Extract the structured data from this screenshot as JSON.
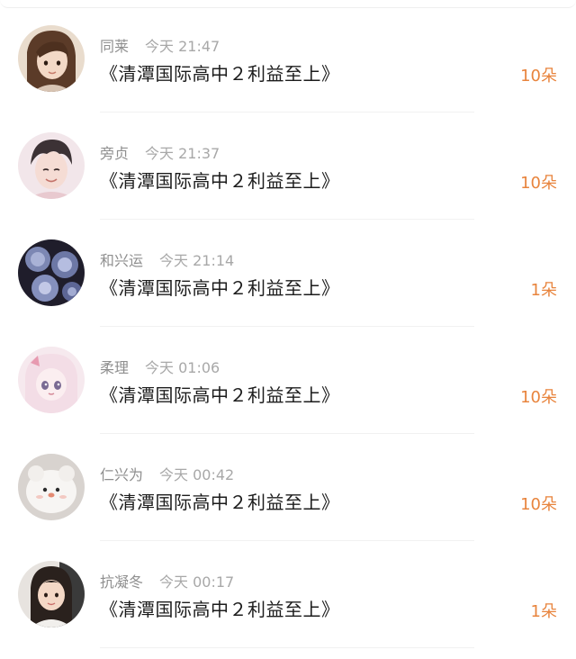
{
  "gifts": [
    {
      "user": "同莱",
      "time": "今天 21:47",
      "book": "《清潭国际高中２利益至上》",
      "count": "10朵",
      "avatar": "girl-drawing-avatar"
    },
    {
      "user": "旁贞",
      "time": "今天 21:37",
      "book": "《清潭国际高中２利益至上》",
      "count": "10朵",
      "avatar": "boy-drawing-avatar"
    },
    {
      "user": "和兴运",
      "time": "今天 21:14",
      "book": "《清潭国际高中２利益至上》",
      "count": "1朵",
      "avatar": "blue-roses-avatar"
    },
    {
      "user": "柔理",
      "time": "今天 01:06",
      "book": "《清潭国际高中２利益至上》",
      "count": "10朵",
      "avatar": "anime-girl-avatar"
    },
    {
      "user": "仁兴为",
      "time": "今天 00:42",
      "book": "《清潭国际高中２利益至上》",
      "count": "10朵",
      "avatar": "plush-toy-avatar"
    },
    {
      "user": "抗凝冬",
      "time": "今天 00:17",
      "book": "《清潭国际高中２利益至上》",
      "count": "1朵",
      "avatar": "child-photo-avatar"
    }
  ],
  "colors": {
    "accent": "#e8843d",
    "meta": "#9a9a9a",
    "title": "#1c1c1c",
    "divider": "#f1f1f1"
  }
}
